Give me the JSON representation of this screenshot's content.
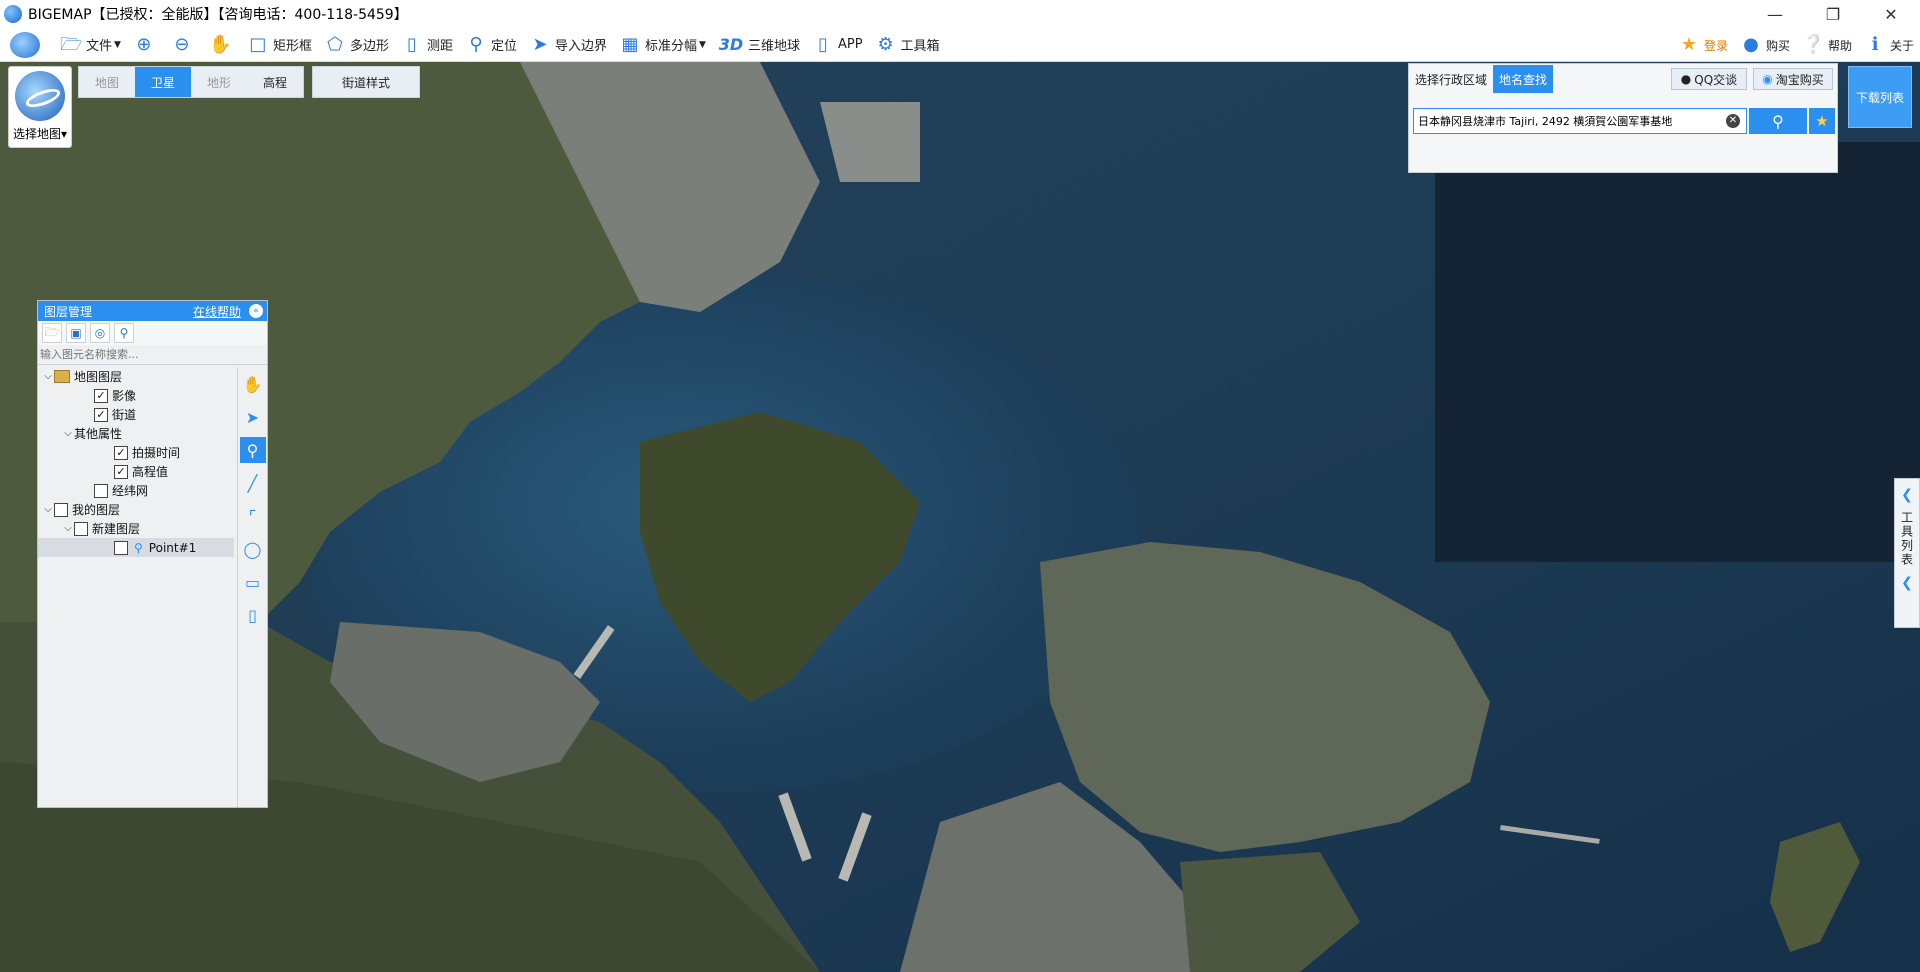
{
  "window": {
    "title": "BIGEMAP【已授权：全能版】【咨询电话：400-118-5459】",
    "controls": [
      "minimize",
      "restore",
      "close"
    ]
  },
  "toolbar": {
    "items": [
      {
        "label": "文件",
        "icon": "folder-icon"
      },
      {
        "label": "",
        "icon": "zoom-in-icon"
      },
      {
        "label": "",
        "icon": "zoom-out-icon"
      },
      {
        "label": "",
        "icon": "hand-icon"
      },
      {
        "label": "矩形框",
        "icon": "rectangle-select-icon"
      },
      {
        "label": "多边形",
        "icon": "polygon-select-icon"
      },
      {
        "label": "测距",
        "icon": "ruler-icon"
      },
      {
        "label": "定位",
        "icon": "location-pin-icon"
      },
      {
        "label": "导入边界",
        "icon": "import-boundary-icon"
      },
      {
        "label": "标准分幅",
        "icon": "grid-icon"
      },
      {
        "label": "三维地球",
        "icon": "3d-icon"
      },
      {
        "label": "APP",
        "icon": "phone-icon"
      },
      {
        "label": "工具箱",
        "icon": "gear-icon"
      }
    ],
    "right": [
      {
        "label": "登录",
        "icon": "vip-icon"
      },
      {
        "label": "购买",
        "icon": "buy-icon"
      },
      {
        "label": "帮助",
        "icon": "help-icon"
      },
      {
        "label": "关于",
        "icon": "info-icon"
      }
    ],
    "three_d_text": "3D"
  },
  "map": {
    "switcher_label": "选择地图",
    "tabs": [
      {
        "label": "地图",
        "active": false
      },
      {
        "label": "卫星",
        "active": true
      },
      {
        "label": "地形",
        "active": false
      },
      {
        "label": "高程",
        "active": false
      }
    ],
    "street_style": "街道样式",
    "download_list": "下载列表",
    "tool_list": "工具列表"
  },
  "search": {
    "tab_region": "选择行政区域",
    "tab_place": "地名查找",
    "qq": "QQ交谈",
    "taobao": "淘宝购买",
    "value": "日本静冈县烧津市 Tajiri, 2492 横須賀公園军事基地"
  },
  "layers": {
    "title": "图层管理",
    "help": "在线帮助",
    "filter_placeholder": "输入图元名称搜索...",
    "tree": [
      {
        "label": "地图图层",
        "level": 0,
        "toggle": "v",
        "checkbox": false,
        "folder": true
      },
      {
        "label": "影像",
        "level": 2,
        "toggle": "",
        "checkbox": true,
        "checked": true
      },
      {
        "label": "街道",
        "level": 2,
        "toggle": "",
        "checkbox": true,
        "checked": true
      },
      {
        "label": "其他属性",
        "level": 1,
        "toggle": "v",
        "checkbox": false
      },
      {
        "label": "拍摄时间",
        "level": 3,
        "toggle": "",
        "checkbox": true,
        "checked": true
      },
      {
        "label": "高程值",
        "level": 3,
        "toggle": "",
        "checkbox": true,
        "checked": true
      },
      {
        "label": "经纬网",
        "level": 2,
        "toggle": "",
        "checkbox": true,
        "checked": false
      },
      {
        "label": "我的图层",
        "level": 0,
        "toggle": "v",
        "checkbox": true,
        "checked": false
      },
      {
        "label": "新建图层",
        "level": 1,
        "toggle": "v",
        "checkbox": true,
        "checked": false
      },
      {
        "label": "Point#1",
        "level": 3,
        "toggle": "",
        "checkbox": true,
        "checked": false,
        "pin": true,
        "selected": true
      }
    ]
  }
}
